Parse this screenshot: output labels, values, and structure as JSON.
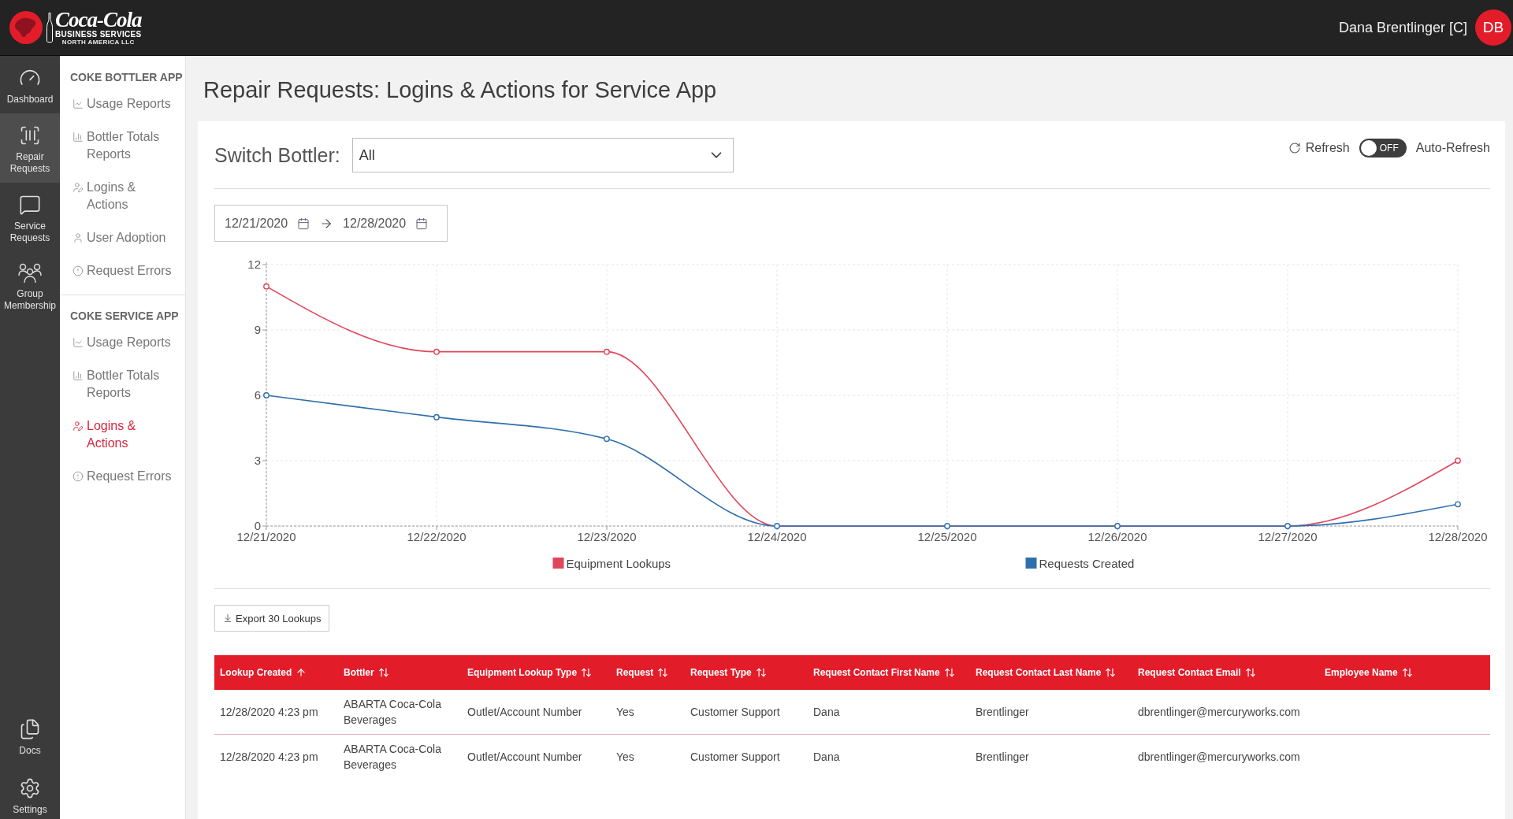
{
  "header": {
    "logo": {
      "wordmark": "Coca-Cola",
      "tagline": "BUSINESS SERVICES",
      "sub_tagline": "NORTH AMERICA LLC"
    },
    "user_name": "Dana Brentlinger [C]",
    "avatar_initials": "DB"
  },
  "nav_rail": {
    "items": [
      {
        "kind": "dashboard",
        "label": "Dashboard",
        "selected": false
      },
      {
        "kind": "repair",
        "label": "Repair Requests",
        "selected": true
      },
      {
        "kind": "service",
        "label": "Service Requests",
        "selected": false
      },
      {
        "kind": "group",
        "label": "Group Membership",
        "selected": false
      }
    ],
    "bottom_items": [
      {
        "kind": "docs",
        "label": "Docs",
        "selected": false
      },
      {
        "kind": "settings",
        "label": "Settings",
        "selected": false
      }
    ]
  },
  "sidebar": {
    "sections": [
      {
        "title": "COKE BOTTLER APP",
        "items": [
          {
            "kind": "usage",
            "label": "Usage Reports",
            "selected": false
          },
          {
            "kind": "totals",
            "label": "Bottler Totals Reports",
            "selected": false
          },
          {
            "kind": "logins",
            "label": "Logins & Actions",
            "selected": false
          },
          {
            "kind": "adoption",
            "label": "User Adoption",
            "selected": false
          },
          {
            "kind": "errors",
            "label": "Request Errors",
            "selected": false
          }
        ]
      },
      {
        "title": "COKE SERVICE APP",
        "items": [
          {
            "kind": "usage",
            "label": "Usage Reports",
            "selected": false
          },
          {
            "kind": "totals",
            "label": "Bottler Totals Reports",
            "selected": false
          },
          {
            "kind": "logins",
            "label": "Logins & Actions",
            "selected": true
          },
          {
            "kind": "errors",
            "label": "Request Errors",
            "selected": false
          }
        ]
      }
    ]
  },
  "page_title": "Repair Requests: Logins & Actions for Service App",
  "filters": {
    "bottler_label": "Switch Bottler:",
    "bottler_select": {
      "value": "All"
    },
    "refresh_label": "Refresh",
    "auto_refresh": {
      "on": false,
      "state_label": "OFF",
      "label": "Auto-Refresh"
    },
    "date_range": {
      "start": "12/21/2020",
      "end": "12/28/2020"
    }
  },
  "chart": {
    "chart_data": {
      "type": "line",
      "categories": [
        "12/21/2020",
        "12/22/2020",
        "12/23/2020",
        "12/24/2020",
        "12/25/2020",
        "12/26/2020",
        "12/27/2020",
        "12/28/2020"
      ],
      "series": [
        {
          "name": "Equipment Lookups",
          "color": "#e0455a",
          "values": [
            11,
            8,
            8,
            0,
            0,
            0,
            0,
            3
          ]
        },
        {
          "name": "Requests Created",
          "color": "#2f6fae",
          "values": [
            6,
            5,
            4,
            0,
            0,
            0,
            0,
            1
          ]
        }
      ],
      "ylim": [
        0,
        12
      ],
      "yticks": [
        0,
        3,
        6,
        9,
        12
      ],
      "grid": true,
      "legend": "bottom",
      "marker": "circle"
    }
  },
  "export_button": {
    "label": "Export 30 Lookups"
  },
  "table": {
    "columns": [
      {
        "label": "Lookup Created",
        "sorted": true
      },
      {
        "label": "Bottler",
        "sorted": false
      },
      {
        "label": "Equipment Lookup Type",
        "sorted": false
      },
      {
        "label": "Request",
        "sorted": false
      },
      {
        "label": "Request Type",
        "sorted": false
      },
      {
        "label": "Request Contact First Name",
        "sorted": false
      },
      {
        "label": "Request Contact Last Name",
        "sorted": false
      },
      {
        "label": "Request Contact Email",
        "sorted": false
      },
      {
        "label": "Employee Name",
        "sorted": false
      }
    ],
    "rows": [
      [
        "12/28/2020 4:23 pm",
        "ABARTA Coca-Cola Beverages",
        "Outlet/Account Number",
        "Yes",
        "Customer Support",
        "Dana",
        "Brentlinger",
        "dbrentlinger@mercuryworks.com"
      ],
      [
        "12/28/2020 4:23 pm",
        "ABARTA Coca-Cola Beverages",
        "Outlet/Account Number",
        "Yes",
        "Customer Support",
        "Dana",
        "Brentlinger",
        "dbrentlinger@mercuryworks.com"
      ]
    ]
  }
}
